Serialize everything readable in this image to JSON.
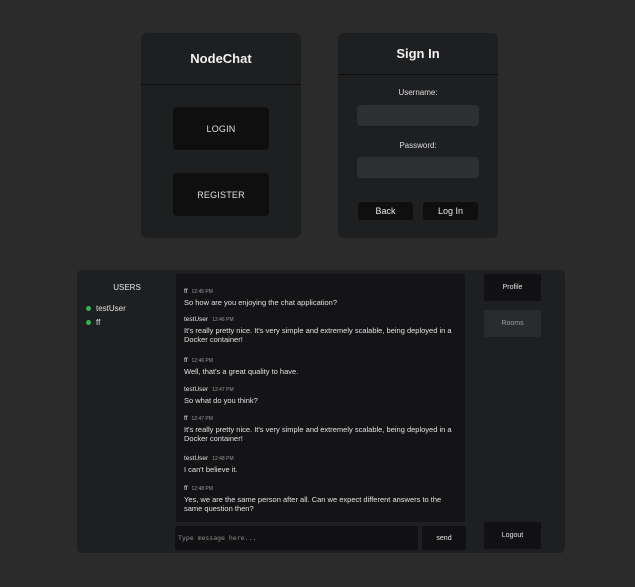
{
  "nodechat": {
    "title": "NodeChat",
    "login_label": "LOGIN",
    "register_label": "REGISTER"
  },
  "signin": {
    "title": "Sign In",
    "username_label": "Username:",
    "password_label": "Password:",
    "back_label": "Back",
    "login_label": "Log In"
  },
  "chat": {
    "users_title": "USERS",
    "users": [
      {
        "name": "testUser",
        "status_color": "#2db84a"
      },
      {
        "name": "ff",
        "status_color": "#2db84a"
      }
    ],
    "messages": [
      {
        "author": "ff",
        "time": "12:45 PM",
        "text": "So how are you enjoying the chat application?"
      },
      {
        "author": "testUser",
        "time": "12:46 PM",
        "text": "It's really pretty nice. It's very simple and extremely scalable, being deployed in a Docker container!"
      },
      {
        "author": "ff",
        "time": "12:46 PM",
        "text": "Well, that's a great quality to have."
      },
      {
        "author": "testUser",
        "time": "12:47 PM",
        "text": "So what do you think?"
      },
      {
        "author": "ff",
        "time": "12:47 PM",
        "text": "It's really pretty nice. It's very simple and extremely scalable, being deployed in a Docker container!"
      },
      {
        "author": "testUser",
        "time": "12:48 PM",
        "text": "I can't believe it."
      },
      {
        "author": "ff",
        "time": "12:48 PM",
        "text": "Yes, we are the same person after all. Can we expect different answers to the same question then?"
      }
    ],
    "input_placeholder": "Type message here...",
    "send_label": "send",
    "profile_label": "Profile",
    "rooms_label": "Rooms",
    "logout_label": "Logout"
  }
}
